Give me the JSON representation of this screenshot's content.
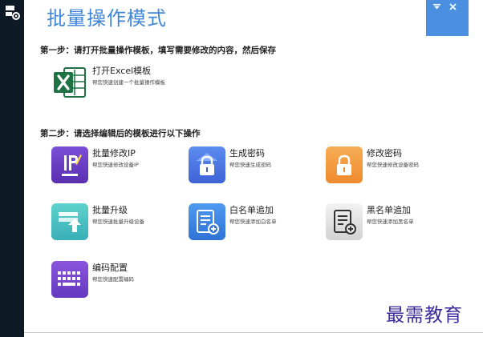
{
  "app": {
    "title": "批量操作模式"
  },
  "window_controls": {
    "minimize_icon": "down-triangle",
    "close_icon": "x"
  },
  "step1": {
    "title": "第一步：请打开批量操作模板，填写需要修改的内容，然后保存",
    "tool": {
      "name": "打开Excel模板",
      "desc": "帮您快速创建一个批量操作模板",
      "icon": "excel-icon",
      "color": "#1f7244"
    }
  },
  "step2": {
    "title": "第二步：请选择编辑后的模板进行以下操作",
    "tools": [
      {
        "name": "批量修改IP",
        "desc": "帮您快速修改设备IP",
        "icon": "ip-edit-icon",
        "color": "#6a44c8"
      },
      {
        "name": "生成密码",
        "desc": "帮您快速生成密码",
        "icon": "lock-icon",
        "color": "#4c79e4"
      },
      {
        "name": "修改密码",
        "desc": "帮您快速修改设备密码",
        "icon": "lock-icon",
        "color": "#f29a3e"
      },
      {
        "name": "批量升级",
        "desc": "帮您快速批量升级设备",
        "icon": "upgrade-icon",
        "color": "#45c0c0"
      },
      {
        "name": "白名单追加",
        "desc": "帮您快速添加白名单",
        "icon": "whitelist-icon",
        "color": "#3f86e0"
      },
      {
        "name": "黑名单追加",
        "desc": "帮您快速添加黑名单",
        "icon": "blacklist-icon",
        "color": "#dcdcdc"
      },
      {
        "name": "编码配置",
        "desc": "帮您快速配置编码",
        "icon": "keyboard-icon",
        "color": "#7b49cf"
      }
    ]
  },
  "watermark": "最需教育"
}
